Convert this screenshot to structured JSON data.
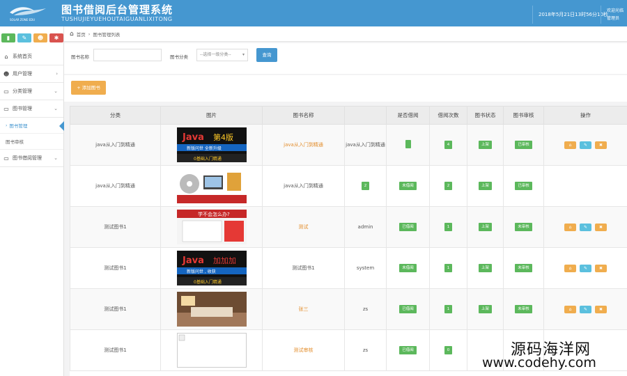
{
  "header": {
    "title": "图书借阅后台管理系统",
    "subtitle": "TUSHUJIEYUEHOUTAIGUANLIXITONG",
    "datetime": "2018年5月21日13时56分10秒",
    "welcome": "欢迎光临",
    "user": "管理员",
    "brand_color": "#4597d0"
  },
  "sidebar": {
    "quick_icons": [
      {
        "name": "chart-icon",
        "glyph": "▮",
        "color": "#5cb85c"
      },
      {
        "name": "pencil-icon",
        "glyph": "✎",
        "color": "#5bc0de"
      },
      {
        "name": "users-icon",
        "glyph": "☻",
        "color": "#f0ad4e"
      },
      {
        "name": "gear-icon",
        "glyph": "✱",
        "color": "#d9534f"
      }
    ],
    "items": [
      {
        "label": "系统首页",
        "icon": "home-icon"
      },
      {
        "label": "用户管理",
        "icon": "users-icon"
      },
      {
        "label": "分类管理",
        "icon": "monitor-icon"
      },
      {
        "label": "图书管理",
        "icon": "monitor-icon"
      },
      {
        "label": "图书管理",
        "icon": "caret-icon"
      },
      {
        "label": "图书审核",
        "icon": ""
      },
      {
        "label": "图书借阅管理",
        "icon": "monitor-icon"
      }
    ]
  },
  "breadcrumb": {
    "home": "首页",
    "current": "图书管理列表"
  },
  "filter": {
    "name_label": "图书名称",
    "name_value": "",
    "category_label": "图书分类",
    "category_placeholder": "--选择一级分类--",
    "search_label": "查询"
  },
  "actions": {
    "add_label": "+ 添加图书"
  },
  "table": {
    "headers": [
      "分类",
      "图片",
      "图书名称",
      "",
      "是否借阅",
      "借阅次数",
      "图书状态",
      "图书审核",
      "操作"
    ],
    "rows": [
      {
        "category": "java从入门到精通",
        "image": "java4",
        "name": "java从入门到精通",
        "owner": "java从入门到精通",
        "borrowed": "",
        "count": "4",
        "status": "上架",
        "audit": "已审核"
      },
      {
        "category": "java从入门到精通",
        "image": "cd",
        "name": "java从入门到精通",
        "owner": "2",
        "borrowed": "未借阅",
        "count": "2",
        "status": "上架",
        "audit": "已审核"
      },
      {
        "category": "测试图书1",
        "image": "ask",
        "name": "测试",
        "owner": "admin",
        "borrowed": "已借阅",
        "count": "1",
        "status": "上架",
        "audit": "未审核"
      },
      {
        "category": "测试图书1",
        "image": "java-plus",
        "name": "测试图书1",
        "owner": "system",
        "borrowed": "未借阅",
        "count": "1",
        "status": "上架",
        "audit": "未审核"
      },
      {
        "category": "测试图书1",
        "image": "room",
        "name": "张三",
        "owner": "zs",
        "borrowed": "已借阅",
        "count": "1",
        "status": "上架",
        "audit": "未审核"
      },
      {
        "category": "测试图书1",
        "image": "broken",
        "name": "测试审核",
        "owner": "zs",
        "borrowed": "已借阅",
        "count": "0",
        "status": "",
        "audit": ""
      }
    ],
    "ops": [
      "⌂",
      "✎",
      "✖"
    ]
  },
  "watermark": {
    "line1": "源码海洋网",
    "line2": "www.codehy.com"
  }
}
